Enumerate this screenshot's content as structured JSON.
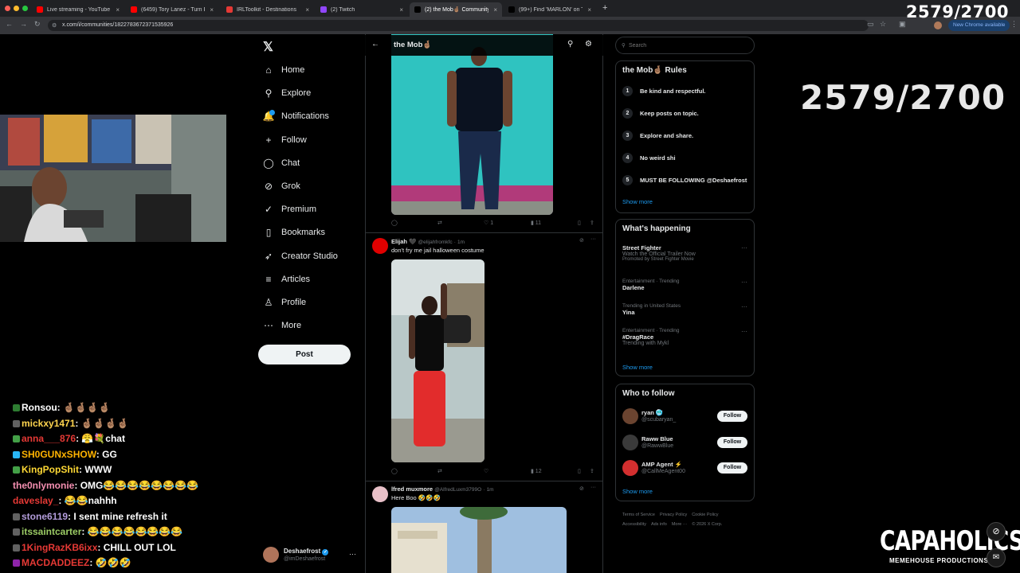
{
  "browser": {
    "tabs": [
      {
        "label": "Live streaming - YouTube Stu",
        "color": "#ff0000"
      },
      {
        "label": "(6459) Tory Lanez - Turn Bac",
        "color": "#ff0000"
      },
      {
        "label": "IRLToolkit - Destinations",
        "color": "#e53935"
      },
      {
        "label": "(2) Twitch",
        "color": "#9146ff"
      },
      {
        "label": "(2) the Mob🤞🏽 Community / X",
        "color": "#000000"
      },
      {
        "label": "(99+) Find 'MARLON' on TikTo",
        "color": "#000000"
      }
    ],
    "url": "x.com/i/communities/1822783672371535926",
    "new_chrome": "New Chrome available"
  },
  "overlay": {
    "counter_top": "2579/2700",
    "counter_big": "2579/2700",
    "brand": "CAPAHOLICS",
    "brand_sub": "MEMEHOUSE PRODUCTIONS"
  },
  "chat": [
    {
      "user": "Ronsou",
      "msg": "🤞🏽🤞🏽🤞🏽🤞🏽",
      "color": "#ffffff",
      "badge": "#2e7d32"
    },
    {
      "user": "mickxy1471",
      "msg": "🤞🏽🤞🏽🤞🏽🤞🏽",
      "color": "#ffd54f",
      "badge": "#616161"
    },
    {
      "user": "anna___876",
      "msg": "😤💐chat",
      "color": "#e53935",
      "badge": "#43a047"
    },
    {
      "user": "SH0GUNxSHOW",
      "msg": "GG",
      "color": "#ffb300",
      "badge": "#29b6f6"
    },
    {
      "user": "KingPopShit",
      "msg": "WWW",
      "color": "#fdd835",
      "badge": "#43a047"
    },
    {
      "user": "the0nlymonie",
      "msg": "OMG😂😂😂😂😂😂😂😂",
      "color": "#f48fb1",
      "badge": ""
    },
    {
      "user": "daveslay_",
      "msg": "😂😂nahhh",
      "color": "#e53935",
      "badge": ""
    },
    {
      "user": "stone6119",
      "msg": "I sent mine refresh it",
      "color": "#b39ddb",
      "badge": "#616161"
    },
    {
      "user": "itssaintcarter",
      "msg": "😂😂😂😂😂😂😂😂",
      "color": "#9ccc65",
      "badge": "#616161"
    },
    {
      "user": "1KingRazKB6ixx",
      "msg": "CHILL OUT LOL",
      "color": "#e53935",
      "badge": "#616161"
    },
    {
      "user": "MACDADDEEZ",
      "msg": "🤣🤣🤣",
      "color": "#e53935",
      "badge": "#8e24aa"
    }
  ],
  "x": {
    "nav": [
      {
        "label": "Home",
        "icon": "home-icon",
        "glyph": "⌂"
      },
      {
        "label": "Explore",
        "icon": "search-icon",
        "glyph": "⚲"
      },
      {
        "label": "Notifications",
        "icon": "bell-icon",
        "glyph": "🔔"
      },
      {
        "label": "Follow",
        "icon": "follow-icon",
        "glyph": "+"
      },
      {
        "label": "Chat",
        "icon": "chat-icon",
        "glyph": "◯"
      },
      {
        "label": "Grok",
        "icon": "grok-icon",
        "glyph": "⊘"
      },
      {
        "label": "Premium",
        "icon": "premium-icon",
        "glyph": "✓"
      },
      {
        "label": "Bookmarks",
        "icon": "bookmark-icon",
        "glyph": "▯"
      },
      {
        "label": "Creator Studio",
        "icon": "rocket-icon",
        "glyph": "➶"
      },
      {
        "label": "Articles",
        "icon": "articles-icon",
        "glyph": "≡"
      },
      {
        "label": "Profile",
        "icon": "profile-icon",
        "glyph": "♙"
      },
      {
        "label": "More",
        "icon": "more-icon",
        "glyph": "⋯"
      }
    ],
    "post_label": "Post",
    "account": {
      "name": "Deshaefrost",
      "handle": "@imDeshaefrost"
    },
    "community_title": "the Mob🤞🏽",
    "posts": [
      {
        "name": "Elijah 🖤",
        "handle": "@elijahfromkfc",
        "time": "1m",
        "text": "don't fry me jail halloween costume",
        "views": "12"
      },
      {
        "name": "lfred muxmore",
        "handle": "@AlfredLuxm3799O",
        "time": "1m",
        "text": "Here Boo 🤣🤣🤣"
      }
    ],
    "first_post_actions": {
      "likes": "1",
      "views": "11"
    },
    "search_placeholder": "Search",
    "rules_title": "the Mob🤞🏽 Rules",
    "rules": [
      "Be kind and respectful.",
      "Keep posts on topic.",
      "Explore and share.",
      "No weird shi",
      "MUST BE FOLLOWING @Deshaefrost"
    ],
    "show_more": "Show more",
    "happening_title": "What's happening",
    "trends": [
      {
        "meta": "",
        "title": "Street Fighter",
        "sub": "Watch the Official Trailer Now",
        "promo": "Promoted by Street Fighter Movie"
      },
      {
        "meta": "Entertainment · Trending",
        "title": "Darlene",
        "sub": "",
        "promo": ""
      },
      {
        "meta": "Trending in United States",
        "title": "Yina",
        "sub": "",
        "promo": ""
      },
      {
        "meta": "Entertainment · Trending",
        "title": "#DragRace",
        "sub": "Trending with Mykl",
        "promo": ""
      }
    ],
    "who_title": "Who to follow",
    "who": [
      {
        "name": "ryan 🥶",
        "handle": "@scubaryan_"
      },
      {
        "name": "Raww Blue",
        "handle": "@RawwBlue"
      },
      {
        "name": "AMP Agent ⚡",
        "handle": "@CallMeAgent00"
      }
    ],
    "follow_label": "Follow",
    "footer": [
      "Terms of Service",
      "Privacy Policy",
      "Cookie Policy",
      "Accessibility",
      "Ads info",
      "More ···",
      "© 2026 X Corp."
    ]
  }
}
